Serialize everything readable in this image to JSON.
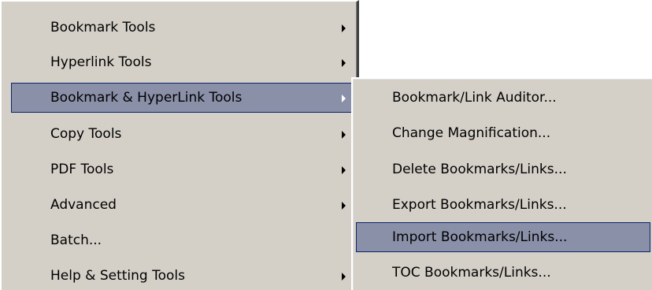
{
  "main_menu": {
    "items": [
      {
        "label": "Bookmark Tools",
        "submenu_arrow": true
      },
      {
        "label": "Hyperlink Tools",
        "submenu_arrow": true
      },
      {
        "label": "Bookmark & HyperLink Tools",
        "submenu_arrow": true,
        "selected": true
      },
      {
        "label": "Copy Tools",
        "submenu_arrow": true
      },
      {
        "label": "PDF Tools",
        "submenu_arrow": true
      },
      {
        "label": "Advanced",
        "submenu_arrow": true
      },
      {
        "label": "Batch...",
        "submenu_arrow": false
      },
      {
        "label": "Help & Setting Tools",
        "submenu_arrow": true
      }
    ]
  },
  "submenu": {
    "items": [
      {
        "label": "Bookmark/Link Auditor..."
      },
      {
        "label": "Change Magnification..."
      },
      {
        "label": "Delete Bookmarks/Links..."
      },
      {
        "label": "Export Bookmarks/Links..."
      },
      {
        "label": "Import Bookmarks/Links...",
        "selected": true
      },
      {
        "label": "TOC Bookmarks/Links..."
      }
    ]
  },
  "colors": {
    "menu_background": "#d4d0c8",
    "selection_background": "#8a90a8",
    "selection_border": "#0a246a",
    "text": "#000000"
  },
  "icons": {
    "submenu_arrow": "triangle-right-icon"
  }
}
